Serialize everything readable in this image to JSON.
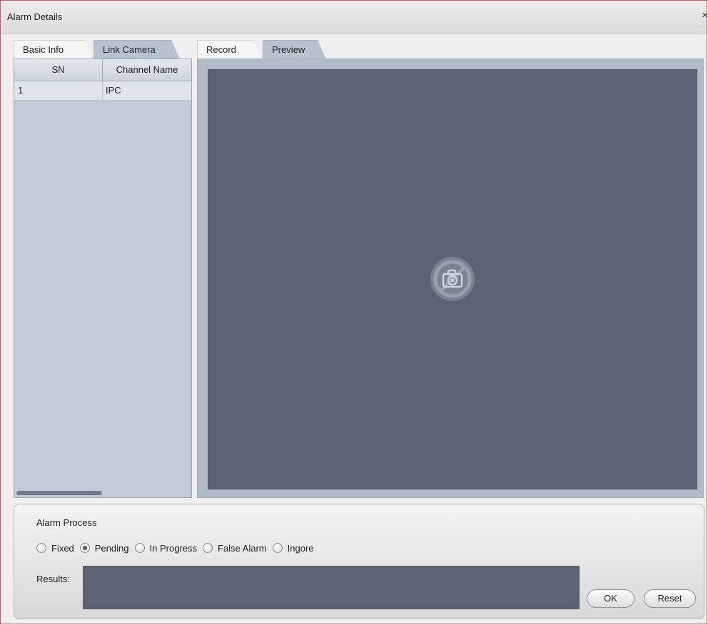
{
  "window": {
    "title": "Alarm Details",
    "close_glyph": "×"
  },
  "left_tabs": [
    {
      "label": "Basic Info",
      "active": false
    },
    {
      "label": "Link Camera",
      "active": true
    }
  ],
  "grid": {
    "columns": [
      "SN",
      "Channel Name"
    ],
    "rows": [
      {
        "sn": "1",
        "name": "IPC"
      }
    ]
  },
  "right_tabs": [
    {
      "label": "Record",
      "active": false
    },
    {
      "label": "Preview",
      "active": true
    }
  ],
  "preview": {
    "icon": "camera-off-icon"
  },
  "alarm_process": {
    "label": "Alarm Process",
    "options": [
      {
        "label": "Fixed",
        "checked": false
      },
      {
        "label": "Pending",
        "checked": true
      },
      {
        "label": "In Progress",
        "checked": false
      },
      {
        "label": "False Alarm",
        "checked": false
      },
      {
        "label": "Ingore",
        "checked": false
      }
    ],
    "results_label": "Results:",
    "results_value": ""
  },
  "buttons": {
    "ok": "OK",
    "reset": "Reset"
  }
}
